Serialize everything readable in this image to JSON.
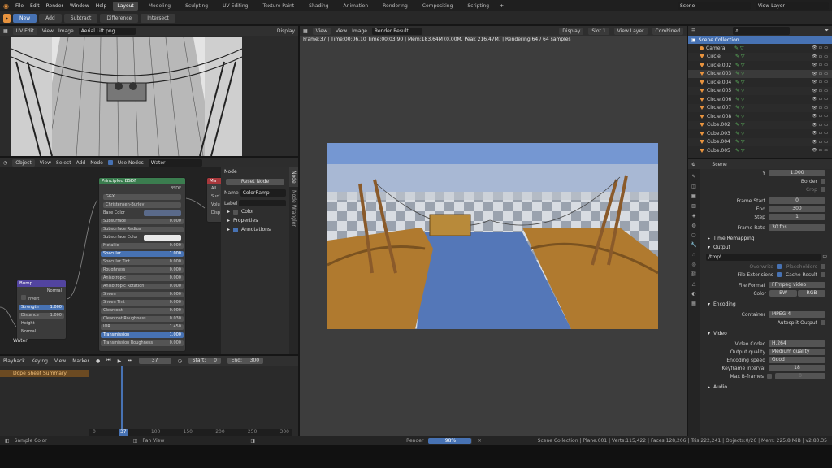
{
  "topbar": {
    "menus": [
      "File",
      "Edit",
      "Render",
      "Window",
      "Help"
    ],
    "workspaces": [
      "Layout",
      "Modeling",
      "Sculpting",
      "UV Editing",
      "Texture Paint",
      "Shading",
      "Animation",
      "Rendering",
      "Compositing",
      "Scripting"
    ],
    "active_workspace": "Layout",
    "scene": "Scene",
    "view_layer": "View Layer"
  },
  "toolbar": {
    "buttons": [
      "New",
      "Add",
      "Subtract",
      "Difference",
      "Intersect"
    ],
    "active": "New"
  },
  "uv_editor": {
    "editor": "UV Edit",
    "menus": [
      "View",
      "Image"
    ],
    "image": "Aerial Lift.png",
    "display": "Display"
  },
  "node_editor": {
    "mode": "Object",
    "menus": [
      "View",
      "Select",
      "Add",
      "Node"
    ],
    "use_nodes": "Use Nodes",
    "material": "Water",
    "principled": {
      "title": "Principled BSDF",
      "output": "BSDF",
      "dist": "GGX",
      "sss": "Christensen-Burley",
      "rows": [
        {
          "label": "Base Color",
          "value": "",
          "kind": "color"
        },
        {
          "label": "Subsurface",
          "value": "0.000",
          "kind": "slider"
        },
        {
          "label": "Subsurface Radius",
          "value": "",
          "kind": "dd"
        },
        {
          "label": "Subsurface Color",
          "value": "",
          "kind": "white"
        },
        {
          "label": "Metallic",
          "value": "0.000",
          "kind": "slider"
        },
        {
          "label": "Specular",
          "value": "1.000",
          "kind": "blue"
        },
        {
          "label": "Specular Tint",
          "value": "0.000",
          "kind": "slider"
        },
        {
          "label": "Roughness",
          "value": "0.000",
          "kind": "slider"
        },
        {
          "label": "Anisotropic",
          "value": "0.000",
          "kind": "slider"
        },
        {
          "label": "Anisotropic Rotation",
          "value": "0.000",
          "kind": "slider"
        },
        {
          "label": "Sheen",
          "value": "0.000",
          "kind": "slider"
        },
        {
          "label": "Sheen Tint",
          "value": "0.000",
          "kind": "slider"
        },
        {
          "label": "Clearcoat",
          "value": "0.000",
          "kind": "slider"
        },
        {
          "label": "Clearcoat Roughness",
          "value": "0.030",
          "kind": "slider"
        },
        {
          "label": "IOR",
          "value": "1.450",
          "kind": "slider"
        },
        {
          "label": "Transmission",
          "value": "1.000",
          "kind": "blue"
        },
        {
          "label": "Transmission Roughness",
          "value": "0.000",
          "kind": "slider"
        }
      ]
    },
    "bump": {
      "title": "Bump",
      "output": "Normal",
      "invert": "Invert",
      "strength_label": "Strength",
      "strength": "1.000",
      "distance_label": "Distance",
      "distance": "1.000",
      "height": "Height",
      "normal": "Normal"
    },
    "output_node": {
      "title": "Ma",
      "items": [
        "All",
        "Surf",
        "Volu",
        "Disp"
      ]
    },
    "bottom_label": "Water",
    "sidebar": {
      "title": "Node",
      "reset": "Reset Node",
      "name_label": "Name",
      "name": "ColorRamp",
      "label_label": "Label",
      "color": "Color",
      "properties": "Properties",
      "annotations": "Annotations",
      "tabs": [
        "Node",
        "Node Wrangler"
      ]
    }
  },
  "render": {
    "menus": [
      "View",
      "View",
      "Image"
    ],
    "result": "Render Result",
    "display": "Display",
    "slot": "Slot 1",
    "view_layer": "View Layer",
    "pass": "Combined",
    "status": "Frame:37 | Time:00:06.10 Time:00:03.90 | Mem:183.64M (0.00M, Peak 216.47M) | Rendering 64 / 64 samples"
  },
  "timeline": {
    "menus": [
      "Playback",
      "Keying",
      "View",
      "Marker"
    ],
    "frame": "37",
    "start_label": "Start:",
    "start": "0",
    "end_label": "End:",
    "end": "300",
    "summary": "Dope Sheet Summary",
    "ticks": [
      "0",
      "37",
      "100",
      "150",
      "200",
      "250",
      "300"
    ]
  },
  "outliner": {
    "root": "Scene Collection",
    "items": [
      "Camera",
      "Circle",
      "Circle.002",
      "Circle.003",
      "Circle.004",
      "Circle.005",
      "Circle.006",
      "Circle.007",
      "Circle.008",
      "Cube.002",
      "Cube.003",
      "Cube.004",
      "Cube.005"
    ]
  },
  "properties": {
    "scene": "Scene",
    "y_label": "Y",
    "y": "1.000",
    "border": "Border",
    "crop": "Crop",
    "frame_start_label": "Frame Start",
    "frame_start": "0",
    "end_label": "End",
    "end": "300",
    "step_label": "Step",
    "step": "1",
    "frame_rate_label": "Frame Rate",
    "frame_rate": "30 fps",
    "time_remapping": "Time Remapping",
    "output": "Output",
    "path": "/tmp\\",
    "overwrite": "Overwrite",
    "placeholders": "Placeholders",
    "file_ext": "File Extensions",
    "cache": "Cache Result",
    "file_format_label": "File Format",
    "file_format": "FFmpeg video",
    "color_label": "Color",
    "bw": "BW",
    "rgb": "RGB",
    "encoding": "Encoding",
    "container_label": "Container",
    "container": "MPEG-4",
    "autosplit": "Autosplit Output",
    "video": "Video",
    "codec_label": "Video Codec",
    "codec": "H.264",
    "quality_label": "Output quality",
    "quality": "Medium quality",
    "speed_label": "Encoding speed",
    "speed": "Good",
    "keyframe_label": "Keyframe interval",
    "keyframe": "18",
    "bframes_label": "Max B-frames",
    "bframes": "0",
    "audio": "Audio"
  },
  "statusbar": {
    "sample": "Sample Color",
    "pan": "Pan View",
    "render_label": "Render",
    "progress_text": "98%",
    "progress": 0.98,
    "stats": "Scene Collection | Plane.001 | Verts:115,422 | Faces:128,206 | Tris:222,241 | Objects:0/26 | Mem: 225.8 MiB | v2.80.35"
  }
}
